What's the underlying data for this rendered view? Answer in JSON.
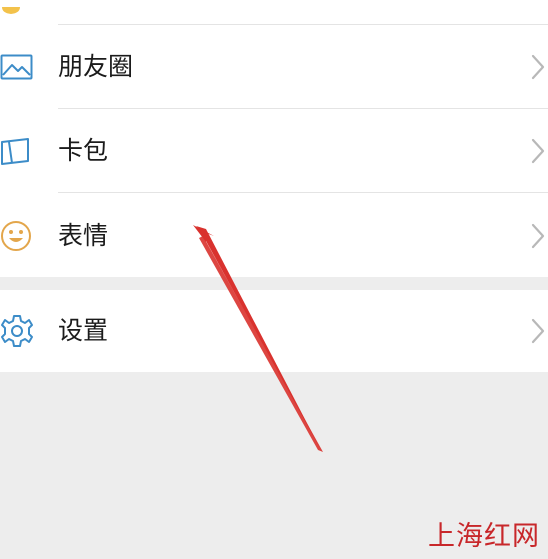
{
  "menu": {
    "items": [
      {
        "label": "朋友圈",
        "icon": "moments-landscape-icon"
      },
      {
        "label": "卡包",
        "icon": "card-wallet-icon"
      },
      {
        "label": "表情",
        "icon": "smiley-face-icon"
      }
    ],
    "settings": {
      "label": "设置",
      "icon": "gear-icon"
    }
  },
  "annotation": {
    "color": "#d9322e"
  },
  "watermark": {
    "text": "上海红网",
    "color": "#c8272a"
  },
  "colors": {
    "icon_blue": "#3c8cc8",
    "icon_orange": "#e3a64b",
    "background": "#ededed",
    "panel": "#ffffff"
  }
}
